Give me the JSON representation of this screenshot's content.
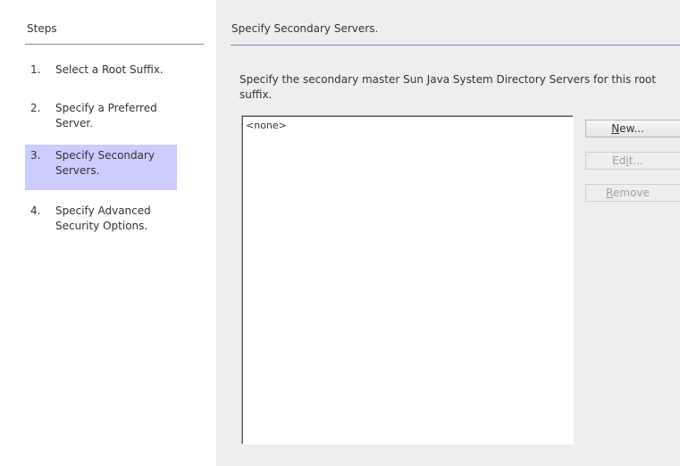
{
  "steps_panel": {
    "title": "Steps",
    "items": [
      {
        "num": "1.",
        "label": "Select a Root Suffix."
      },
      {
        "num": "2.",
        "label": "Specify a Preferred Server."
      },
      {
        "num": "3.",
        "label": "Specify Secondary Servers.",
        "selected": true
      },
      {
        "num": "4.",
        "label": "Specify Advanced Security Options."
      }
    ]
  },
  "main": {
    "title": "Specify Secondary Servers.",
    "description": "Specify the secondary master Sun Java System Directory Servers for this root suffix.",
    "list_items": [
      "<none>"
    ]
  },
  "buttons": {
    "new": {
      "mnemonic": "N",
      "rest": "ew..."
    },
    "edit": {
      "pre": "Ed",
      "mnemonic": "i",
      "rest": "t..."
    },
    "remove": {
      "mnemonic": "R",
      "rest": "emove"
    }
  },
  "colors": {
    "selected_step": "#ccccff",
    "panel_background": "#eeeeee",
    "rule": "#7b8aa8"
  }
}
